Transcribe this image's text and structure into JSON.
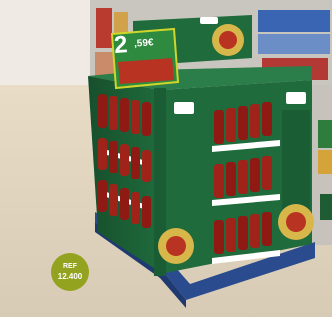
{
  "price_tag": {
    "big": "2",
    "small": ",59€"
  },
  "reference_badge": {
    "label": "REF",
    "code": "12.400"
  },
  "colors": {
    "display_green": "#1f6b3c",
    "bottle_red": "#8f1a14",
    "pallet_blue": "#2a4c8e",
    "badge_green": "#93a21f"
  }
}
